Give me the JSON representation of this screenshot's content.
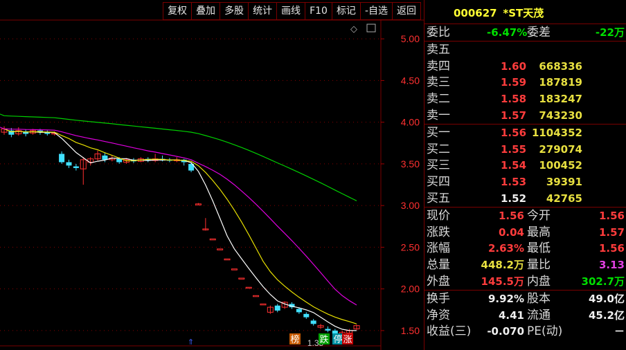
{
  "toolbar": [
    "复权",
    "叠加",
    "多股",
    "统计",
    "画线",
    "F10",
    "标记",
    "-自选",
    "返回"
  ],
  "stock": {
    "code": "000627",
    "name": "*ST天茂"
  },
  "webi": {
    "l1": "委比",
    "v1": "-6.47%",
    "l2": "委差",
    "v2": "-22万"
  },
  "asks": [
    {
      "label": "卖五",
      "price": "",
      "vol": ""
    },
    {
      "label": "卖四",
      "price": "1.60",
      "vol": "668336"
    },
    {
      "label": "卖三",
      "price": "1.59",
      "vol": "187819"
    },
    {
      "label": "卖二",
      "price": "1.58",
      "vol": "183247"
    },
    {
      "label": "卖一",
      "price": "1.57",
      "vol": "743230"
    }
  ],
  "bids": [
    {
      "label": "买一",
      "price": "1.56",
      "vol": "1104352"
    },
    {
      "label": "买二",
      "price": "1.55",
      "vol": "279074"
    },
    {
      "label": "买三",
      "price": "1.54",
      "vol": "100452"
    },
    {
      "label": "买四",
      "price": "1.53",
      "vol": "39391"
    },
    {
      "label": "买五",
      "price": "1.52",
      "vol": "42765"
    }
  ],
  "stats1": [
    {
      "l1": "现价",
      "v1": "1.56",
      "l2": "今开",
      "v2": "1.56"
    },
    {
      "l1": "涨跌",
      "v1": "0.04",
      "l2": "最高",
      "v2": "1.57"
    },
    {
      "l1": "涨幅",
      "v1": "2.63%",
      "l2": "最低",
      "v2": "1.56"
    },
    {
      "l1": "总量",
      "v1": "448.2万",
      "l2": "量比",
      "v2": "3.13"
    },
    {
      "l1": "外盘",
      "v1": "145.5万",
      "l2": "内盘",
      "v2": "302.7万"
    }
  ],
  "stats2": [
    {
      "l1": "换手",
      "v1": "9.92%",
      "l2": "股本",
      "v2": "49.0亿"
    },
    {
      "l1": "净资",
      "v1": "4.41",
      "l2": "流通",
      "v2": "45.2亿"
    },
    {
      "l1": "收益(三)",
      "v1": "-0.070",
      "l2": "PE(动)",
      "v2": "－"
    }
  ],
  "chart_data": {
    "type": "candlestick",
    "yticks": [
      "5.00",
      "4.50",
      "4.00",
      "3.50",
      "3.00",
      "2.50",
      "2.00",
      "1.50"
    ],
    "ylim": [
      1.35,
      5.3
    ],
    "low_label": "1.35",
    "markers": [
      "榜",
      "跌",
      "停",
      "涨"
    ],
    "colors": {
      "up": "#ff3030",
      "down": "#40e0ff",
      "ma5": "#ffffff",
      "ma10": "#e8e000",
      "ma20": "#e000e0",
      "ma60": "#00d000"
    },
    "candles": [
      [
        3.88,
        3.92,
        3.95,
        3.85
      ],
      [
        3.9,
        3.85,
        3.93,
        3.82
      ],
      [
        3.86,
        3.9,
        3.94,
        3.84
      ],
      [
        3.89,
        3.86,
        3.91,
        3.83
      ],
      [
        3.87,
        3.9,
        3.92,
        3.85
      ],
      [
        3.9,
        3.88,
        3.92,
        3.85
      ],
      [
        3.88,
        3.86,
        3.9,
        3.84
      ],
      [
        3.86,
        3.87,
        3.89,
        3.84
      ],
      [
        3.62,
        3.52,
        3.65,
        3.5
      ],
      [
        3.52,
        3.48,
        3.55,
        3.45
      ],
      [
        3.47,
        3.45,
        3.5,
        3.42
      ],
      [
        3.44,
        3.55,
        3.58,
        3.25
      ],
      [
        3.52,
        3.56,
        3.58,
        3.48
      ],
      [
        3.56,
        3.62,
        3.66,
        3.54
      ],
      [
        3.6,
        3.55,
        3.63,
        3.52
      ],
      [
        3.55,
        3.57,
        3.6,
        3.53
      ],
      [
        3.56,
        3.52,
        3.58,
        3.5
      ],
      [
        3.52,
        3.55,
        3.57,
        3.5
      ],
      [
        3.55,
        3.53,
        3.57,
        3.51
      ],
      [
        3.53,
        3.56,
        3.58,
        3.52
      ],
      [
        3.56,
        3.54,
        3.58,
        3.52
      ],
      [
        3.54,
        3.56,
        3.62,
        3.52
      ],
      [
        3.56,
        3.54,
        3.6,
        3.53
      ],
      [
        3.55,
        3.54,
        3.57,
        3.52
      ],
      [
        3.54,
        3.55,
        3.58,
        3.52
      ],
      [
        3.55,
        3.52,
        3.56,
        3.48
      ],
      [
        3.5,
        3.42,
        3.52,
        3.4
      ],
      [
        3.02,
        3.02,
        3.03,
        3.01
      ],
      [
        2.72,
        2.72,
        2.85,
        2.7
      ],
      [
        2.6,
        2.6,
        2.6,
        2.6
      ],
      [
        2.48,
        2.48,
        2.48,
        2.48
      ],
      [
        2.36,
        2.36,
        2.36,
        2.36
      ],
      [
        2.24,
        2.24,
        2.24,
        2.24
      ],
      [
        2.13,
        2.13,
        2.13,
        2.13
      ],
      [
        2.02,
        2.02,
        2.02,
        2.02
      ],
      [
        1.92,
        1.92,
        1.92,
        1.92
      ],
      [
        1.82,
        1.82,
        1.82,
        1.82
      ],
      [
        1.72,
        1.78,
        1.8,
        1.7
      ],
      [
        1.8,
        1.74,
        1.82,
        1.72
      ],
      [
        1.78,
        1.84,
        1.85,
        1.76
      ],
      [
        1.82,
        1.78,
        1.84,
        1.76
      ],
      [
        1.76,
        1.72,
        1.78,
        1.7
      ],
      [
        1.7,
        1.66,
        1.72,
        1.64
      ],
      [
        1.62,
        1.58,
        1.64,
        1.56
      ],
      [
        1.54,
        1.56,
        1.58,
        1.52
      ],
      [
        1.52,
        1.5,
        1.55,
        1.48
      ],
      [
        1.5,
        1.46,
        1.52,
        1.35
      ],
      [
        1.44,
        1.48,
        1.5,
        1.42
      ],
      [
        1.47,
        1.5,
        1.52,
        1.45
      ],
      [
        1.52,
        1.56,
        1.57,
        1.51
      ]
    ]
  }
}
